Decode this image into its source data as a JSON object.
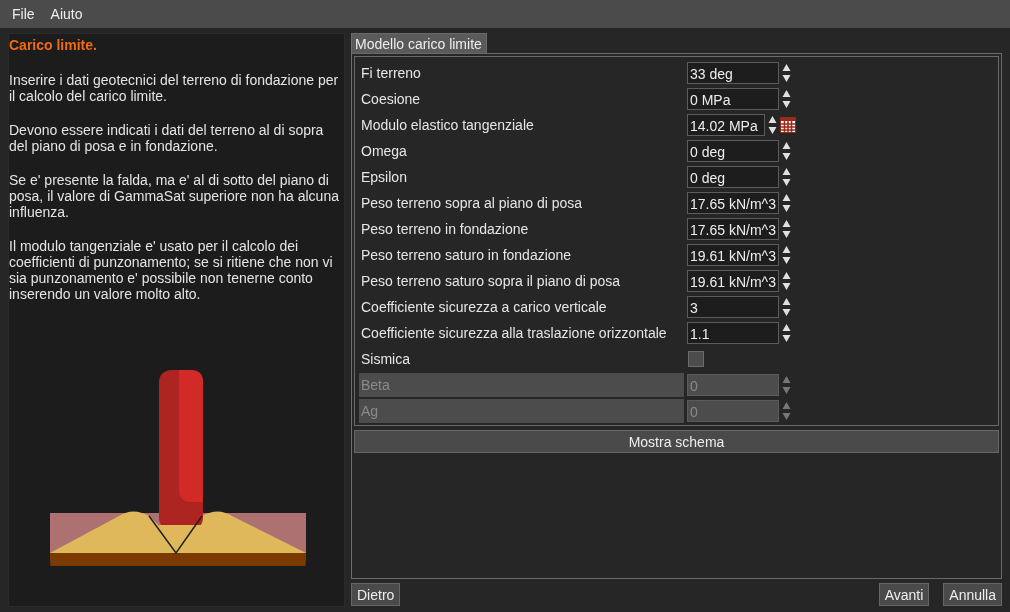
{
  "menu": [
    "File",
    "Aiuto"
  ],
  "help": {
    "title": "Carico limite.",
    "paragraphs": [
      "Inserire i dati geotecnici del terreno di fondazione per il calcolo del carico limite.",
      "Devono essere indicati i dati del terreno al di sopra del piano di posa e in fondazione.",
      "Se e' presente la falda, ma e' al di sotto del piano di posa, il valore di GammaSat superiore non ha alcuna influenza.",
      "Il modulo tangenziale e' usato per il calcolo dei coefficienti di punzonamento; se si ritiene che non vi sia punzonamento e' possibile non tenerne conto inserendo un valore molto alto."
    ]
  },
  "tab": {
    "label": "Modello carico limite",
    "selected": true
  },
  "rows": [
    {
      "label": "Fi terreno",
      "kind": "spin",
      "value": "33 deg",
      "disabled": false
    },
    {
      "label": "Coesione",
      "kind": "spin",
      "value": "0 MPa",
      "disabled": false
    },
    {
      "label": "Modulo elastico tangenziale",
      "kind": "spin_calc",
      "value": "14.02 MPa",
      "disabled": false
    },
    {
      "label": "Omega",
      "kind": "spin",
      "value": "0 deg",
      "disabled": false
    },
    {
      "label": "Epsilon",
      "kind": "spin",
      "value": "0 deg",
      "disabled": false
    },
    {
      "label": "Peso terreno sopra al piano di posa",
      "kind": "spin",
      "value": "17.65 kN/m^3",
      "disabled": false
    },
    {
      "label": "Peso terreno in fondazione",
      "kind": "spin",
      "value": "17.65 kN/m^3",
      "disabled": false
    },
    {
      "label": "Peso terreno saturo in fondazione",
      "kind": "spin",
      "value": "19.61 kN/m^3",
      "disabled": false
    },
    {
      "label": "Peso terreno saturo sopra il piano di posa",
      "kind": "spin",
      "value": "19.61 kN/m^3",
      "disabled": false
    },
    {
      "label": "Coefficiente sicurezza a carico verticale",
      "kind": "spin",
      "value": "3",
      "disabled": false
    },
    {
      "label": "Coefficiente sicurezza alla traslazione orizzontale",
      "kind": "spin",
      "value": "1.1",
      "disabled": false
    },
    {
      "label": "Sismica",
      "kind": "check",
      "checked": false,
      "disabled": false
    },
    {
      "label": "Beta",
      "kind": "spin",
      "value": "0",
      "disabled": true
    },
    {
      "label": "Ag",
      "kind": "spin",
      "value": "0",
      "disabled": true
    }
  ],
  "show_button": "Mostra schema",
  "back_button": "Dietro",
  "next_button": "Avanti",
  "cancel_button": "Annulla"
}
